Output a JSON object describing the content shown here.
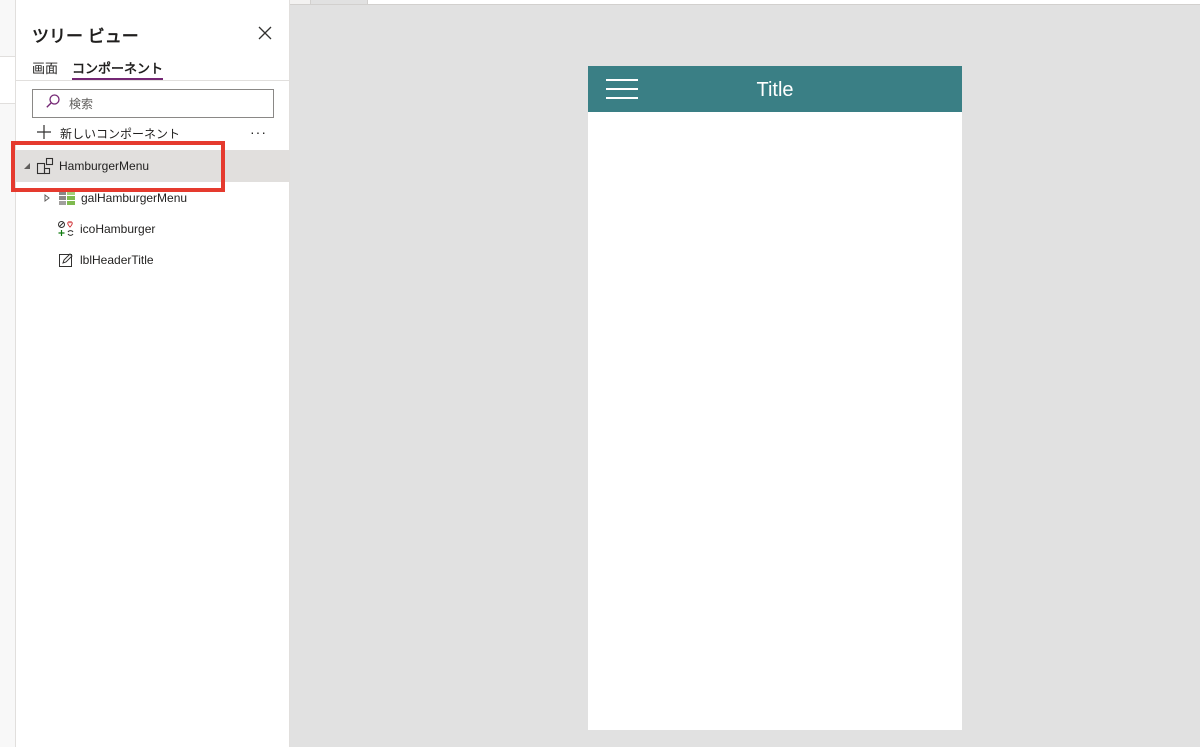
{
  "tree_view": {
    "title": "ツリー ビュー",
    "tabs": [
      {
        "label": "画面",
        "active": false
      },
      {
        "label": "コンポーネント",
        "active": true
      }
    ],
    "search": {
      "placeholder": "検索",
      "value": ""
    },
    "new_component_label": "新しいコンポーネント",
    "more_label": "···",
    "items": [
      {
        "label": "HamburgerMenu",
        "icon": "component-icon",
        "expanded": true,
        "selected": true
      },
      {
        "label": "galHamburgerMenu",
        "icon": "gallery-icon",
        "expanded": false
      },
      {
        "label": "icoHamburger",
        "icon": "icons-icon"
      },
      {
        "label": "lblHeaderTitle",
        "icon": "label-icon"
      }
    ]
  },
  "canvas": {
    "header_title": "Title",
    "header_color": "#3a7f85"
  },
  "colors": {
    "accent": "#742774",
    "highlight": "#e53a2e"
  }
}
